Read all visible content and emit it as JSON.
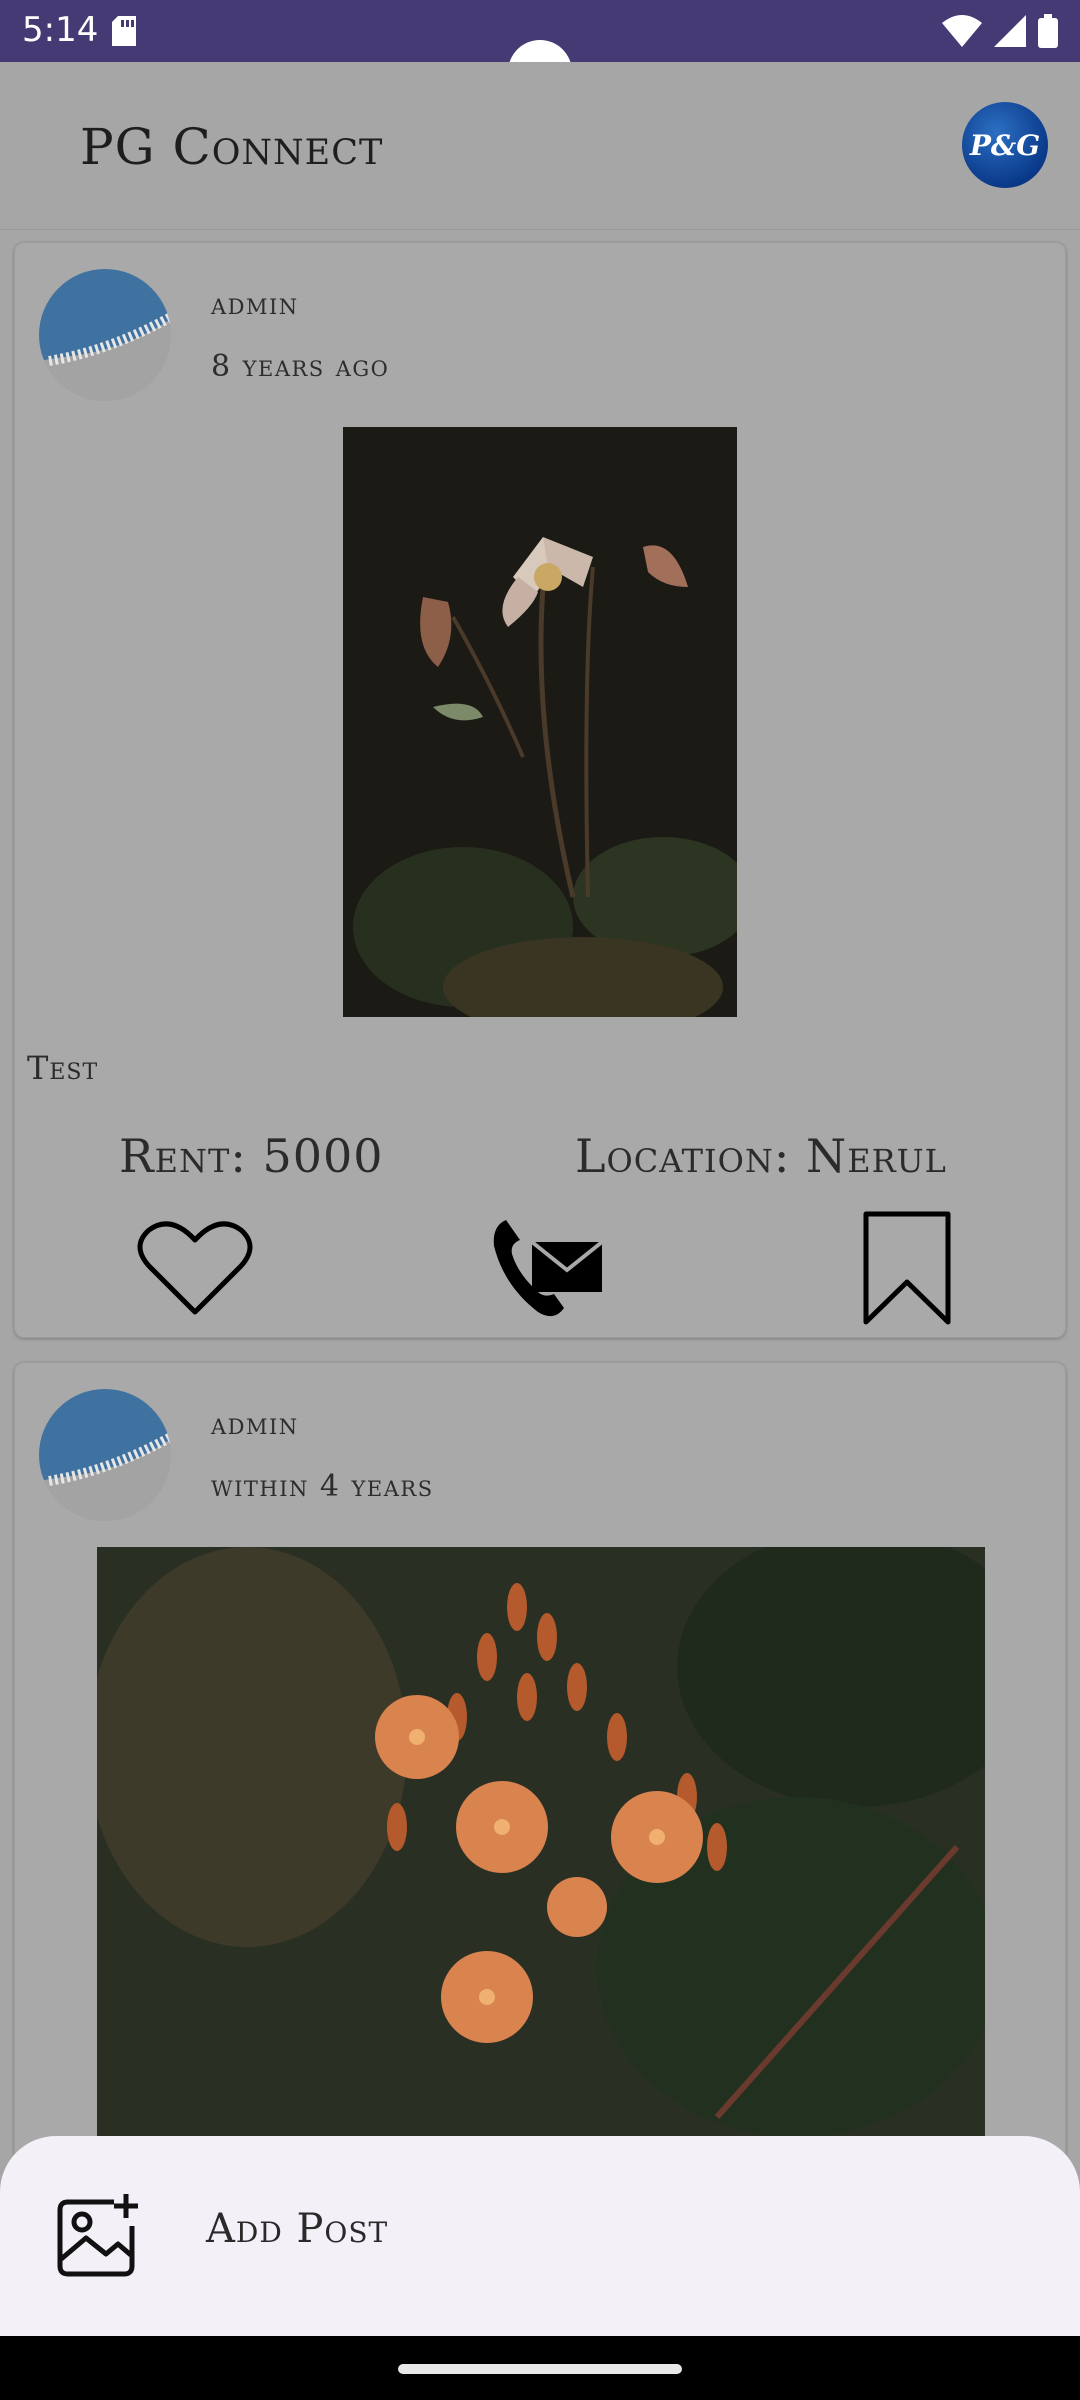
{
  "status_bar": {
    "time": "5:14",
    "icons": [
      "sd-card-icon",
      "wifi-icon",
      "signal-icon",
      "battery-icon"
    ]
  },
  "app_bar": {
    "title": "PG Connect",
    "logo_text": "P&G"
  },
  "posts": [
    {
      "user": "admin",
      "time": "8 years ago",
      "image": "dark-white-flower-photo",
      "caption": "Test",
      "rent": "Rent: 5000",
      "location": "Location: Nerul",
      "actions": [
        "heart-icon",
        "phone-mail-icon",
        "bookmark-icon"
      ]
    },
    {
      "user": "admin",
      "time": "within 4 years",
      "image": "orange-flower-cluster-photo"
    }
  ],
  "bottom_sheet": {
    "label": "Add Post",
    "icon": "add-image-icon"
  },
  "colors": {
    "status_bar": "#453a73",
    "scrim_bg": "#a6a6a6",
    "sheet_bg": "#f4f0f8",
    "logo_blue": "#0a3a8a"
  }
}
